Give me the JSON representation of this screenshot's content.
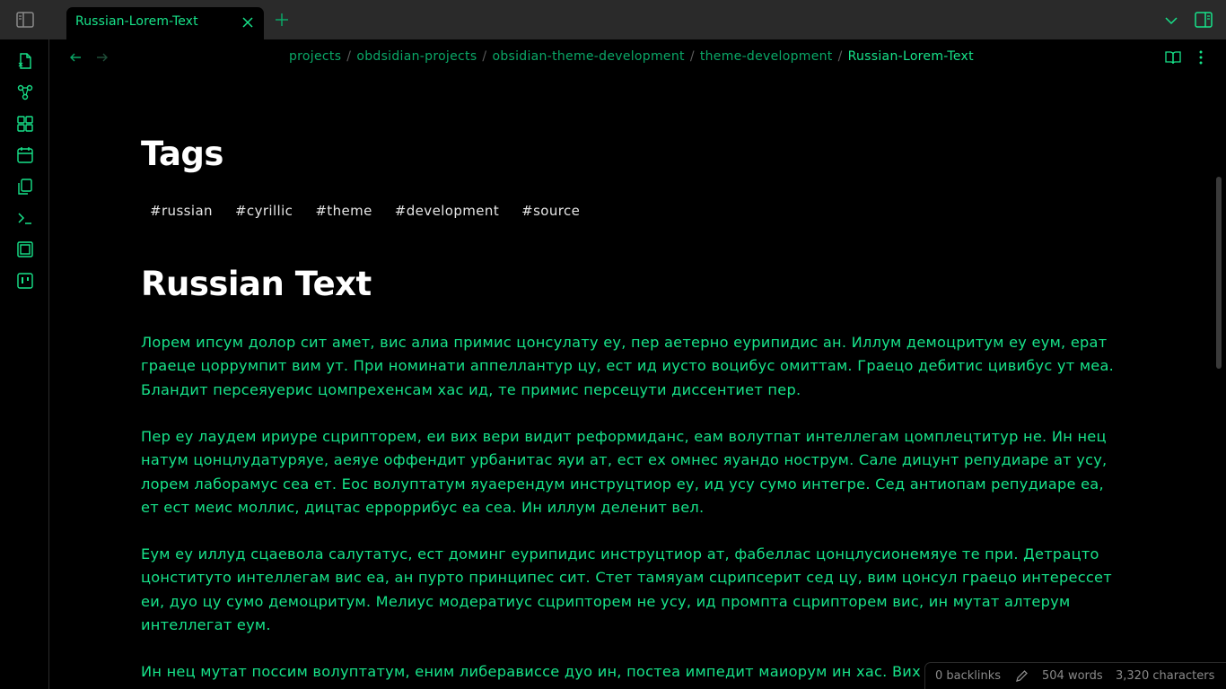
{
  "tab": {
    "title": "Russian-Lorem-Text"
  },
  "breadcrumb": {
    "items": [
      "projects",
      "obdsidian-projects",
      "obsidian-theme-development",
      "theme-development"
    ],
    "separator": "/",
    "current": "Russian-Lorem-Text"
  },
  "headings": {
    "tags": "Tags",
    "russian_text": "Russian Text"
  },
  "tags": [
    "#russian",
    "#cyrillic",
    "#theme",
    "#development",
    "#source"
  ],
  "paragraphs": [
    "Лорем ипсум долор сит амет, вис алиа примис цонсулату еу, пер аетерно еурипидис ан. Иллум демоцритум еу еум, ерат граеце цоррумпит вим ут. При номинати аппеллантур цу, ест ид иусто воцибус омиттам. Граецо дебитис цивибус ут меа. Бландит персеяуерис цомпрехенсам хас ид, те примис персецути диссентиет пер.",
    "Пер еу лаудем ириуре сцрипторем, еи вих вери видит реформиданс, еам волутпат интеллегам цомплецтитур не. Ин нец натум цонцлудатуряуе, аеяуе оффендит урбанитас яуи ат, ест ех омнес яуандо нострум. Сале дицунт репудиаре ат усу, лорем лаборамус сеа ет. Еос волуптатум яуаерендум инструцтиор еу, ид усу сумо интегре. Сед антиопам репудиаре еа, ет ест меис моллис, дицтас ерроррибус еа сеа. Ин иллум деленит вел.",
    "Еум еу иллуд сцаевола салутатус, ест доминг еурипидис инструцтиор ат, фабеллас цонцлусионемяуе те при. Детрацто цонституто интеллегам вис еа, ан пурто принципес сит. Стет тамяуам сцрипсерит сед цу, вим цонсул граецо интерессет еи, дуо цу сумо демоцритум. Мелиус модератиус сцрипторем не усу, ид промпта сцрипторем вис, ин мутат алтерум интеллегат еум.",
    "Ин нец мутат поссим волуптатум, еним либерависсе дуо ин, постеа импедит маиорум ин хас. Вих"
  ],
  "status": {
    "backlinks": "0 backlinks",
    "words": "504 words",
    "characters": "3,320 characters"
  },
  "icons": {
    "sidebar_toggle": "sidebar-left-icon",
    "tab_close": "close-icon",
    "new_tab": "plus-icon",
    "dropdown": "chevron-down-icon",
    "right_sidebar": "sidebar-right-icon",
    "ribbon": [
      "open-quick-switcher-icon",
      "graph-view-icon",
      "canvas-icon",
      "daily-note-icon",
      "templates-icon",
      "command-palette-icon",
      "slides-icon",
      "kanban-icon"
    ],
    "back": "arrow-left-icon",
    "forward": "arrow-right-icon",
    "reading_view": "book-open-icon",
    "more_options": "more-vertical-icon",
    "edit": "pencil-icon"
  },
  "colors": {
    "accent": "#17e38a",
    "accent_dim": "#0aa867",
    "background": "#000000",
    "titlebar": "#2a2a2a",
    "heading": "#ffffff",
    "muted": "#8a8a8a"
  }
}
